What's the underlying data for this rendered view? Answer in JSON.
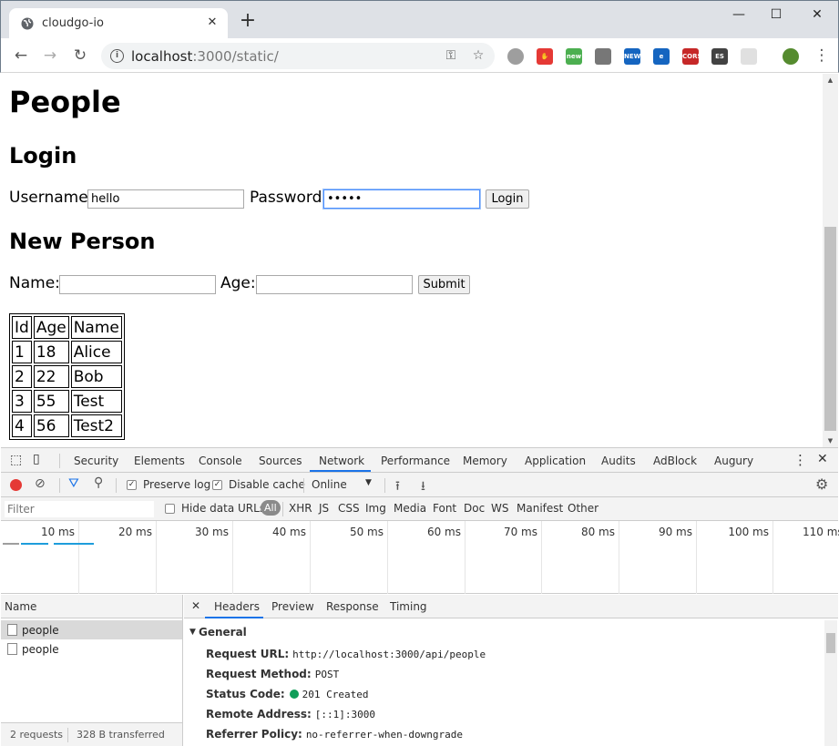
{
  "browser": {
    "tab_title": "cloudgo-io",
    "url_host": "localhost",
    "url_path": ":3000/static/",
    "new_tab_glyph": "+",
    "extensions": [
      {
        "name": "green-dot-extension-icon",
        "label": "",
        "color": "#9e9e9e"
      },
      {
        "name": "adblock-extension-icon",
        "label": "✋",
        "color": "#e53935"
      },
      {
        "name": "screenshot-new-extension-icon",
        "label": "new",
        "color": "#4caf50"
      },
      {
        "name": "glasses-extension-icon",
        "label": "",
        "color": "#777777"
      },
      {
        "name": "news-extension-icon",
        "label": "NEW",
        "color": "#1565c0"
      },
      {
        "name": "e-extension-icon",
        "label": "e",
        "color": "#1565c0"
      },
      {
        "name": "cors-extension-icon",
        "label": "CORS",
        "color": "#c62828"
      },
      {
        "name": "es-extension-icon",
        "label": "ES",
        "color": "#424242"
      },
      {
        "name": "gear-grey-extension-icon",
        "label": "",
        "color": "#e0e0e0"
      },
      {
        "name": "avatar-extension-icon",
        "label": "",
        "color": "#558b2f"
      }
    ]
  },
  "page": {
    "title": "People",
    "login": {
      "heading": "Login",
      "username_label": "Username:",
      "username_value": "hello",
      "password_label": "Password:",
      "password_value": "•••••",
      "button": "Login"
    },
    "new_person": {
      "heading": "New Person",
      "name_label": "Name:",
      "name_value": "",
      "age_label": "Age:",
      "age_value": "",
      "button": "Submit"
    },
    "table": {
      "headers": [
        "Id",
        "Age",
        "Name"
      ],
      "rows": [
        [
          "1",
          "18",
          "Alice"
        ],
        [
          "2",
          "22",
          "Bob"
        ],
        [
          "3",
          "55",
          "Test"
        ],
        [
          "4",
          "56",
          "Test2"
        ]
      ]
    }
  },
  "devtools": {
    "tabs": [
      "Security",
      "Elements",
      "Console",
      "Sources",
      "Network",
      "Performance",
      "Memory",
      "Application",
      "Audits",
      "AdBlock",
      "Augury"
    ],
    "active_tab": "Network",
    "preserve_log": "Preserve log",
    "disable_cache": "Disable cache",
    "throttle": "Online",
    "filter_placeholder": "Filter",
    "hide_data_urls": "Hide data URLs",
    "filter_types": [
      "All",
      "XHR",
      "JS",
      "CSS",
      "Img",
      "Media",
      "Font",
      "Doc",
      "WS",
      "Manifest",
      "Other"
    ],
    "ruler_labels": [
      "10 ms",
      "20 ms",
      "30 ms",
      "40 ms",
      "50 ms",
      "60 ms",
      "70 ms",
      "80 ms",
      "90 ms",
      "100 ms",
      "110 ms"
    ],
    "name_header": "Name",
    "requests": [
      "people",
      "people"
    ],
    "status_bar": {
      "requests": "2 requests",
      "transferred": "328 B transferred"
    },
    "detail_tabs": [
      "Headers",
      "Preview",
      "Response",
      "Timing"
    ],
    "detail_active": "Headers",
    "general": {
      "section": "General",
      "rows": [
        {
          "key": "Request URL:",
          "value": "http://localhost:3000/api/people"
        },
        {
          "key": "Request Method:",
          "value": "POST"
        },
        {
          "key": "Status Code:",
          "value": "201 Created"
        },
        {
          "key": "Remote Address:",
          "value": "[::1]:3000"
        },
        {
          "key": "Referrer Policy:",
          "value": "no-referrer-when-downgrade"
        }
      ],
      "status_color": "#0f9d58"
    }
  }
}
